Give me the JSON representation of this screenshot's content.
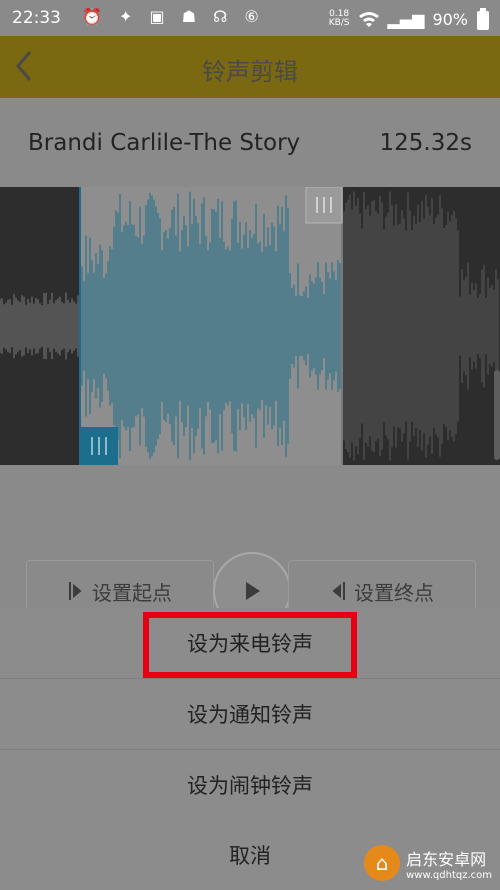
{
  "status": {
    "time": "22:33",
    "left_icons": "⏰ ✦ ▣ ☗ ☊ ⑥",
    "speed_top": "0.18",
    "speed_bottom": "KB/S",
    "signal": "▂▄▆",
    "battery": "90%"
  },
  "header": {
    "title": "铃声剪辑",
    "back_icon": "chevron-left-icon"
  },
  "song": {
    "name": "Brandi Carlile-The Story",
    "duration": "125.32s"
  },
  "controls": {
    "set_start": "设置起点",
    "set_end": "设置终点"
  },
  "sheet": {
    "items": [
      "设为来电铃声",
      "设为通知铃声",
      "设为闹钟铃声",
      "取消"
    ]
  },
  "watermark": {
    "text": "启东安卓网",
    "url": "www.qdhtqz.com"
  },
  "colors": {
    "accent": "#c7a400",
    "wave_selected": "#1c6f8c",
    "highlight": "#e60012"
  }
}
